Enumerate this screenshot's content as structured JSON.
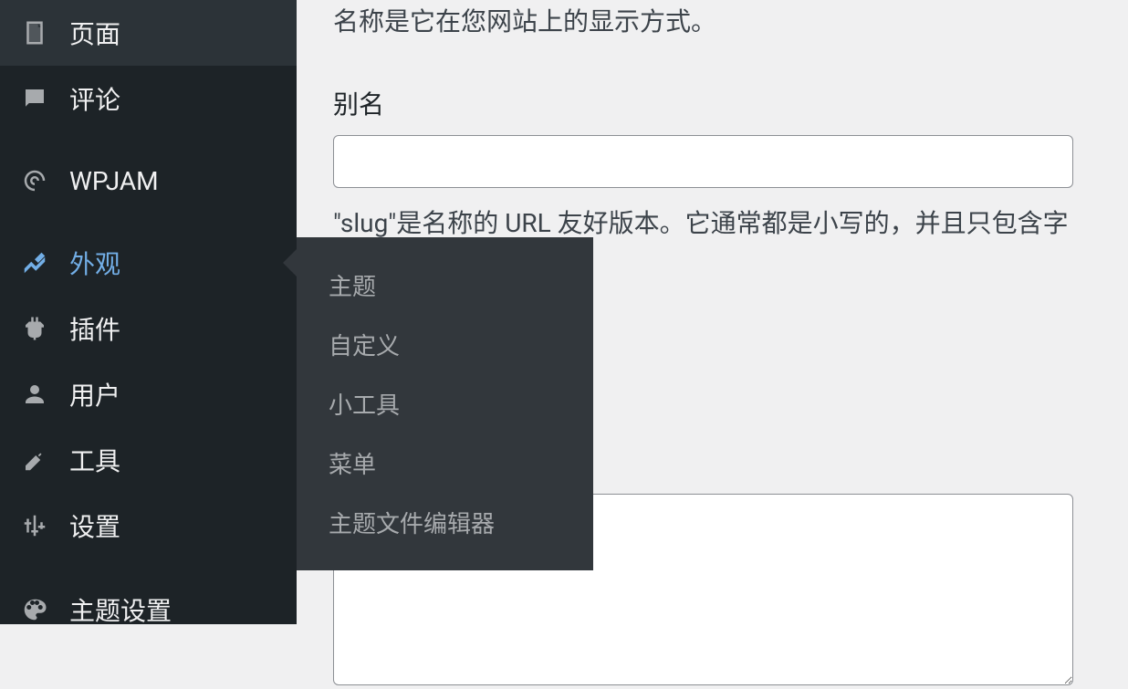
{
  "sidebar": {
    "items": [
      {
        "label": "页面",
        "icon": "page"
      },
      {
        "label": "评论",
        "icon": "comment"
      },
      {
        "label": "WPJAM",
        "icon": "dashboard"
      },
      {
        "label": "外观",
        "icon": "appearance",
        "active": true
      },
      {
        "label": "插件",
        "icon": "plugin"
      },
      {
        "label": "用户",
        "icon": "user"
      },
      {
        "label": "工具",
        "icon": "tool"
      },
      {
        "label": "设置",
        "icon": "settings"
      },
      {
        "label": "主题设置",
        "icon": "theme"
      }
    ]
  },
  "submenu": {
    "items": [
      {
        "label": "主题"
      },
      {
        "label": "自定义"
      },
      {
        "label": "小工具"
      },
      {
        "label": "菜单"
      },
      {
        "label": "主题文件编辑器"
      }
    ]
  },
  "main": {
    "name_help": "名称是它在您网站上的显示方式。",
    "slug_label": "别名",
    "slug_help": "\"slug\"是名称的 URL 友好版本。它通常都是小写的，并且只包含字母、数字和连字符。"
  }
}
